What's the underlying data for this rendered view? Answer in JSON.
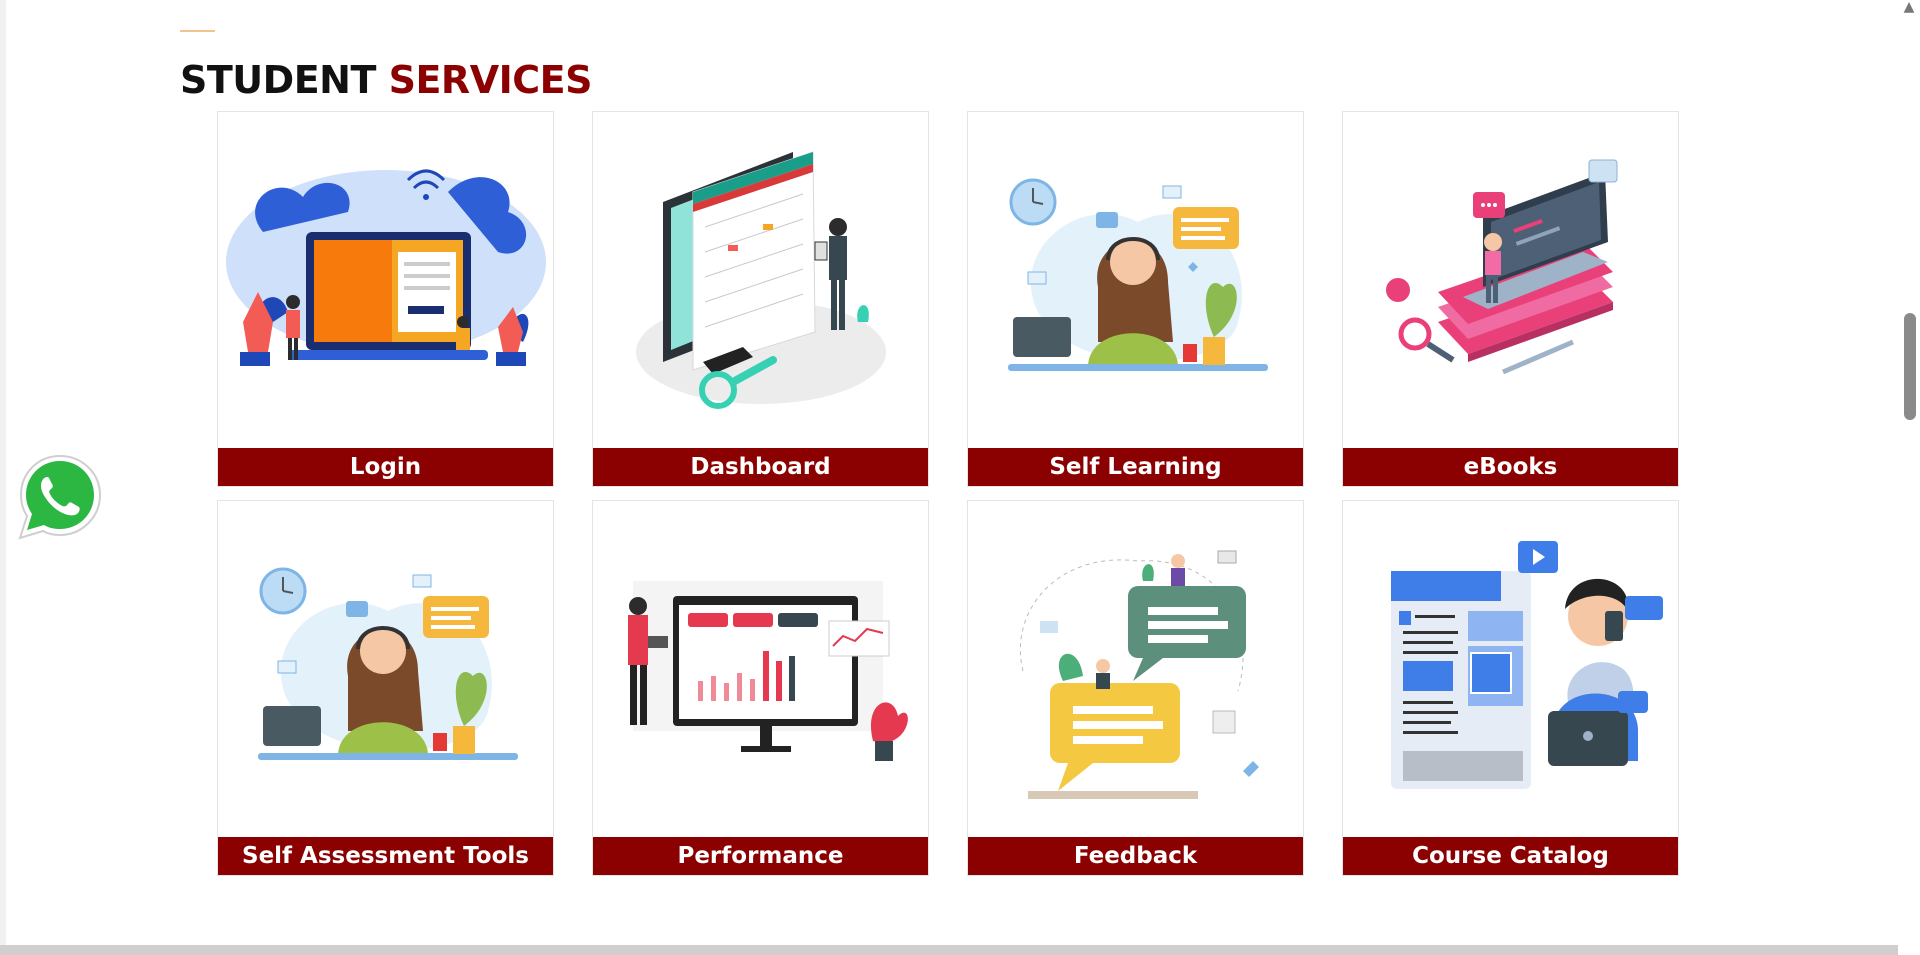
{
  "section": {
    "title_part1": "STUDENT",
    "title_part2": "SERVICES"
  },
  "services": [
    {
      "label": "Login",
      "icon": "laptop-login-illustration"
    },
    {
      "label": "Dashboard",
      "icon": "dashboard-monitor-illustration"
    },
    {
      "label": "Self Learning",
      "icon": "headset-learner-illustration"
    },
    {
      "label": "eBooks",
      "icon": "laptop-books-illustration"
    },
    {
      "label": "Self Assessment Tools",
      "icon": "headset-learner-illustration"
    },
    {
      "label": "Performance",
      "icon": "bar-chart-monitor-illustration"
    },
    {
      "label": "Feedback",
      "icon": "chat-bubbles-illustration"
    },
    {
      "label": "Course Catalog",
      "icon": "blog-catalog-illustration"
    }
  ],
  "floating": {
    "whatsapp_icon": "whatsapp-icon"
  },
  "colors": {
    "accent_red": "#8b0000",
    "title_black": "#111111",
    "whatsapp_green": "#2cb742"
  }
}
